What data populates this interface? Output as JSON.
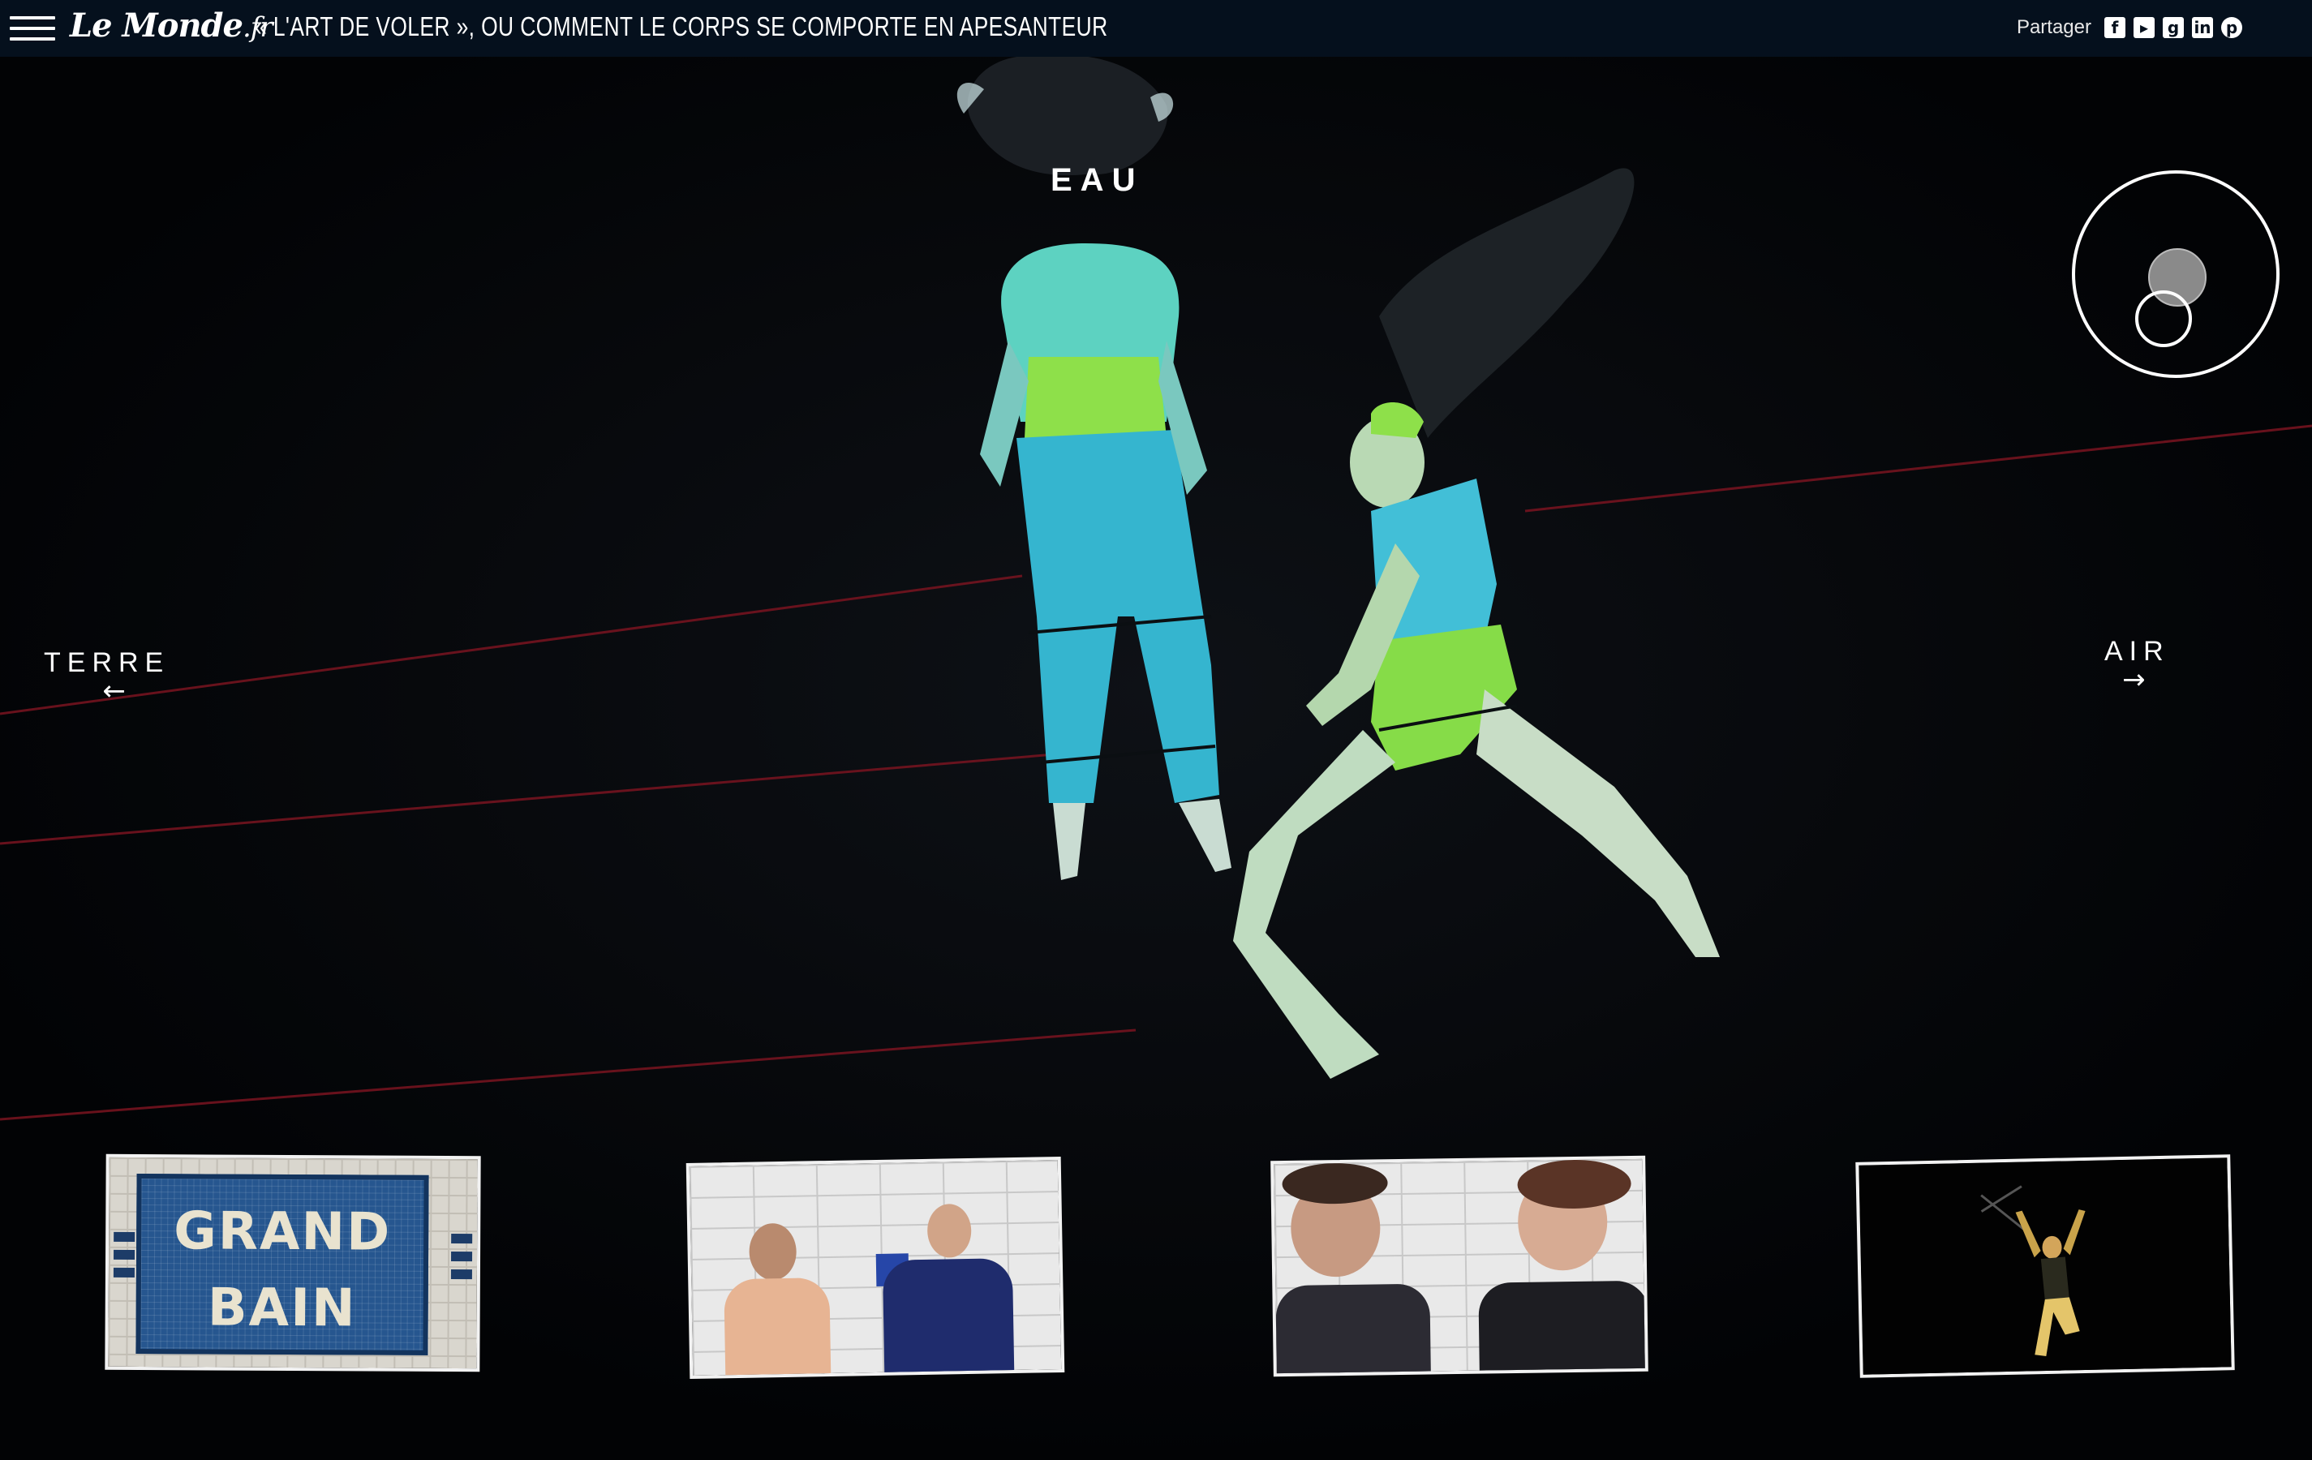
{
  "header": {
    "logo": "Le Monde",
    "logo_suffix": ".fr",
    "headline": "« L'ART DE VOLER », OU COMMENT LE CORPS SE COMPORTE EN APESANTEUR",
    "share_label": "Partager",
    "share_icons": [
      "facebook-icon",
      "twitter-icon",
      "google-plus-icon",
      "linkedin-icon",
      "pinterest-icon"
    ]
  },
  "scene": {
    "section_title": "EAU",
    "nav_left": {
      "label": "TERRE",
      "arrow": "←"
    },
    "nav_right": {
      "label": "AIR",
      "arrow": "→"
    }
  },
  "thumbnails": [
    {
      "name": "grand-bain",
      "line1": "GRAND",
      "line2": "BAIN"
    },
    {
      "name": "interview-duo"
    },
    {
      "name": "interview-women"
    },
    {
      "name": "aerial-performer"
    }
  ],
  "colors": {
    "topbar": "#05101d",
    "background": "#030408",
    "dancer_top": "#8be04e",
    "dancer_pants": "#37b8cf",
    "laser": "#8a1420"
  }
}
